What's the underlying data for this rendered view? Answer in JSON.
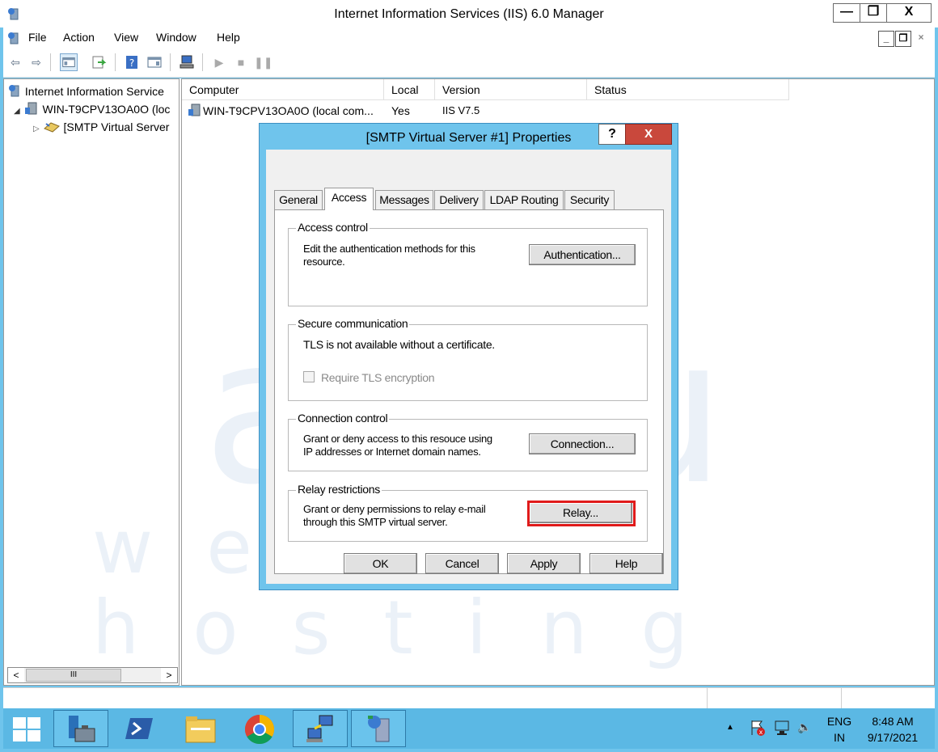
{
  "window": {
    "title": "Internet Information Services (IIS) 6.0 Manager",
    "min_glyph": "—",
    "max_glyph": "❐",
    "close_glyph": "X"
  },
  "menu": {
    "items": [
      "File",
      "Action",
      "View",
      "Window",
      "Help"
    ]
  },
  "mdi": {
    "min": "_",
    "restore": "❐",
    "close": "×"
  },
  "tree": {
    "root": "Internet Information Service",
    "server": "WIN-T9CPV13OA0O (loc",
    "smtp": "[SMTP Virtual Server"
  },
  "list": {
    "columns": [
      "Computer",
      "Local",
      "Version",
      "Status"
    ],
    "rows": [
      {
        "computer": "WIN-T9CPV13OA0O (local com...",
        "local": "Yes",
        "version": "IIS V7.5",
        "status": ""
      }
    ]
  },
  "scroll": {
    "left": "<",
    "thumb": "III",
    "right": ">"
  },
  "dialog": {
    "title": "[SMTP Virtual Server #1] Properties",
    "help": "?",
    "close": "X",
    "tabs": [
      "General",
      "Access",
      "Messages",
      "Delivery",
      "LDAP Routing",
      "Security"
    ],
    "active_tab": "Access",
    "access_control": {
      "label": "Access control",
      "text_line1": "Edit the authentication methods for this",
      "text_line2": "resource.",
      "button": "Authentication..."
    },
    "secure": {
      "label": "Secure communication",
      "text": "TLS is not available without a certificate.",
      "checkbox_label": "Require TLS encryption",
      "checked": false
    },
    "connection": {
      "label": "Connection control",
      "text_line1": "Grant or deny access to this resouce using",
      "text_line2": "IP addresses or Internet domain names.",
      "button": "Connection..."
    },
    "relay": {
      "label": "Relay restrictions",
      "text_line1": "Grant or deny permissions to relay e-mail",
      "text_line2": "through this SMTP virtual server.",
      "button": "Relay..."
    },
    "buttons": {
      "ok": "OK",
      "cancel": "Cancel",
      "apply": "Apply",
      "help": "Help"
    }
  },
  "watermark": {
    "big": "accu",
    "small": "web hosting"
  },
  "tray": {
    "lang_line1": "ENG",
    "lang_line2": "IN",
    "time": "8:48 AM",
    "date": "9/17/2021",
    "up_arrow": "▲"
  },
  "colors": {
    "accent": "#6fc4ec",
    "taskbar": "#5bb8e4",
    "highlight": "#e01b1b"
  }
}
